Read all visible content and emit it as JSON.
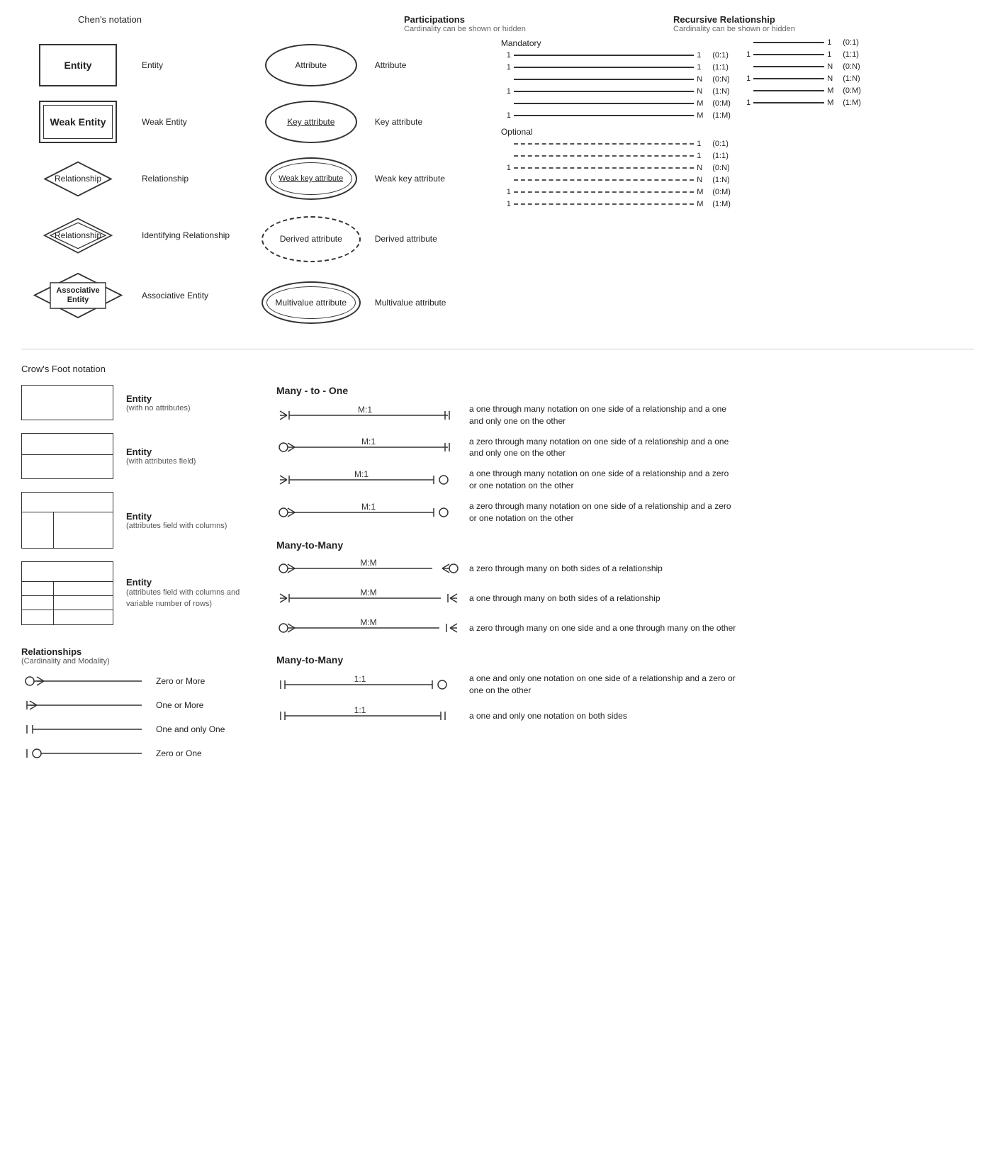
{
  "chens_notation": {
    "title": "Chen's notation",
    "entities": [
      {
        "symbol_label": "Entity",
        "desc_label": "Entity"
      },
      {
        "symbol_label": "Weak Entity",
        "desc_label": "Weak Entity"
      },
      {
        "symbol_label": "Relationship",
        "desc_label": "Relationship"
      },
      {
        "symbol_label": "Relationship",
        "desc_label": "Identifying Relationship"
      },
      {
        "symbol_label": "Associative\nEntity",
        "desc_label": "Associative Entity"
      }
    ],
    "attributes": [
      {
        "symbol_label": "Attribute",
        "desc_label": "Attribute"
      },
      {
        "symbol_label": "Key attribute",
        "desc_label": "Key attribute"
      },
      {
        "symbol_label": "Weak key attribute",
        "desc_label": "Weak key attribute"
      },
      {
        "symbol_label": "Derived attribute",
        "desc_label": "Derived attribute"
      },
      {
        "symbol_label": "Multivalue attribute",
        "desc_label": "Multivalue attribute"
      }
    ]
  },
  "participations": {
    "title": "Participations",
    "subtitle": "Cardinality can be shown or hidden",
    "mandatory_label": "Mandatory",
    "optional_label": "Optional",
    "mandatory_rows": [
      {
        "left": "1",
        "right": "1",
        "notation": "(0:1)"
      },
      {
        "left": "1",
        "right": "1",
        "notation": "(1:1)"
      },
      {
        "left": "",
        "right": "N",
        "notation": "(0:N)"
      },
      {
        "left": "1",
        "right": "N",
        "notation": "(1:N)"
      },
      {
        "left": "",
        "right": "M",
        "notation": "(0:M)"
      },
      {
        "left": "1",
        "right": "M",
        "notation": "(1:M)"
      }
    ],
    "optional_rows": [
      {
        "left": "",
        "right": "1",
        "notation": "(0:1)"
      },
      {
        "left": "",
        "right": "1",
        "notation": "(1:1)"
      },
      {
        "left": "1",
        "right": "N",
        "notation": "(0:N)"
      },
      {
        "left": "",
        "right": "N",
        "notation": "(1:N)"
      },
      {
        "left": "1",
        "right": "M",
        "notation": "(0:M)"
      },
      {
        "left": "1",
        "right": "M",
        "notation": "(1:M)"
      }
    ]
  },
  "recursive": {
    "title": "Recursive Relationship",
    "subtitle": "Cardinality can be shown or hidden",
    "rows": [
      {
        "left": "",
        "right": "1",
        "notation": "(0:1)"
      },
      {
        "left": "1",
        "right": "1",
        "notation": "(1:1)"
      },
      {
        "left": "",
        "right": "N",
        "notation": "(0:N)"
      },
      {
        "left": "1",
        "right": "N",
        "notation": "(1:N)"
      },
      {
        "left": "",
        "right": "M",
        "notation": "(0:M)"
      },
      {
        "left": "1",
        "right": "M",
        "notation": "(1:M)"
      }
    ]
  },
  "crows_foot": {
    "title": "Crow's Foot notation",
    "entities": [
      {
        "type": "simple",
        "label": "Entity",
        "sublabel": "(with no attributes)"
      },
      {
        "type": "attr",
        "label": "Entity",
        "sublabel": "(with attributes field)"
      },
      {
        "type": "cols",
        "label": "Entity",
        "sublabel": "(attributes field with columns)"
      },
      {
        "type": "variable",
        "label": "Entity",
        "sublabel": "(attributes field with columns and\nvariable number of rows)"
      }
    ],
    "relationships_title": "Relationships",
    "relationships_subtitle": "(Cardinality and Modality)",
    "symbols": [
      {
        "label": "Zero or More"
      },
      {
        "label": "One or More"
      },
      {
        "label": "One and only One"
      },
      {
        "label": "Zero or One"
      }
    ]
  },
  "many_to_one": {
    "title": "Many - to - One",
    "rows": [
      {
        "label": "M:1",
        "desc": "a one through many notation on one side of a relationship and a one and only one on the other"
      },
      {
        "label": "M:1",
        "desc": "a zero through many notation on one side of a relationship and a one and only one on the other"
      },
      {
        "label": "M:1",
        "desc": "a one through many notation on one side of a relationship and a zero or one notation on the other"
      },
      {
        "label": "M:1",
        "desc": "a zero through many notation on one side of a relationship and a zero or one notation on the other"
      }
    ]
  },
  "many_to_many": {
    "title": "Many-to-Many",
    "rows": [
      {
        "label": "M:M",
        "desc": "a zero through many on both sides of a relationship"
      },
      {
        "label": "M:M",
        "desc": "a one through many on both sides of a relationship"
      },
      {
        "label": "M:M",
        "desc": "a zero through many on one side and a one through many on the other"
      }
    ]
  },
  "many_to_many2": {
    "title": "Many-to-Many",
    "rows": [
      {
        "label": "1:1",
        "desc": "a one and only one notation on one side of a relationship and a zero or one on the other"
      },
      {
        "label": "1:1",
        "desc": "a one and only one notation on both sides"
      }
    ]
  }
}
